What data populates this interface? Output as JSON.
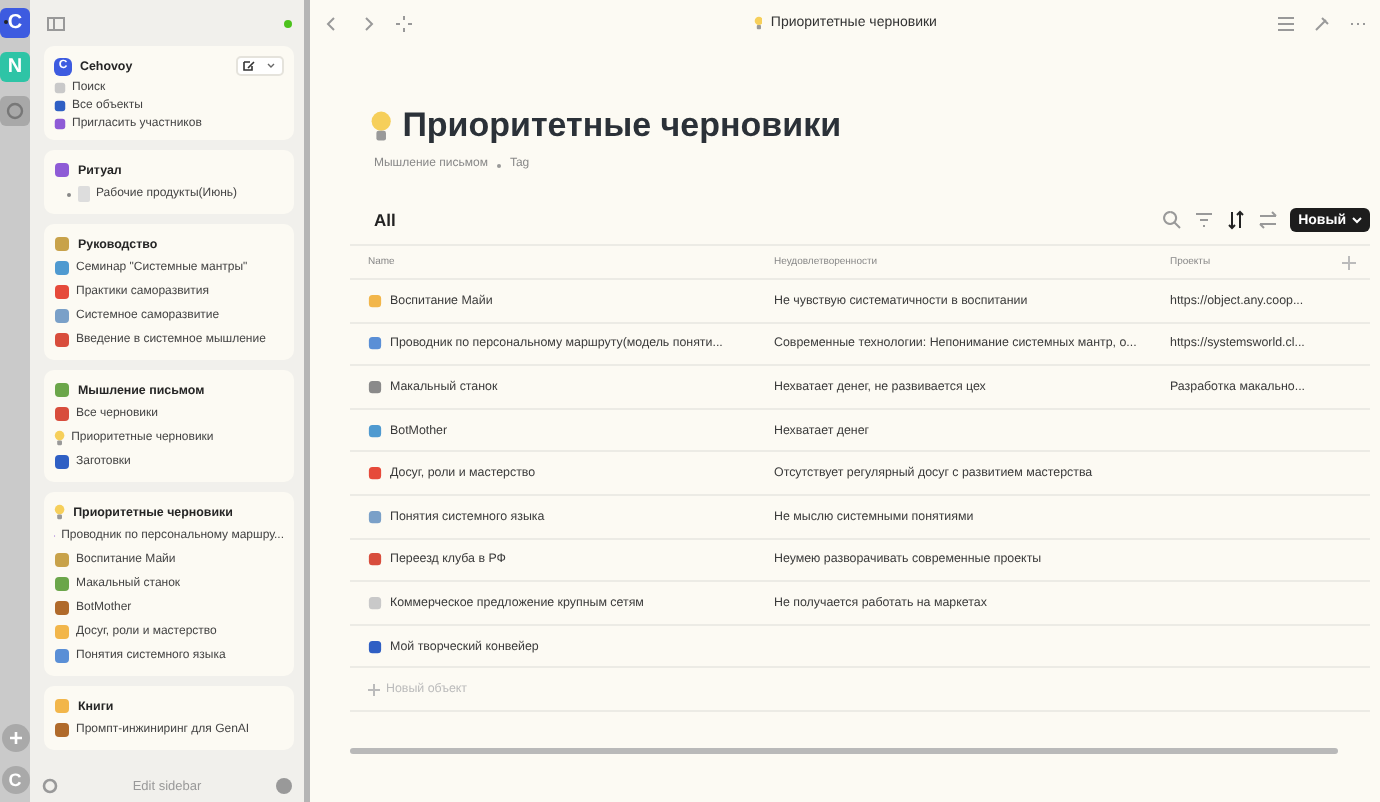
{
  "rail": {
    "spaces": [
      {
        "letter": "C",
        "color": "#3d5be0",
        "selected": true
      },
      {
        "letter": "N",
        "color": "#2ec4a6",
        "selected": false
      }
    ],
    "account": "C"
  },
  "sidebar": {
    "space": {
      "name": "Cehovoy",
      "logo": "C",
      "items": [
        "Поиск",
        "Все объекты",
        "Пригласить участников"
      ]
    },
    "widgets": [
      {
        "title": "Ритуал",
        "kind": "tree",
        "items": [
          "Рабочие продукты(Июнь)"
        ]
      },
      {
        "title": "Руководство",
        "kind": "list",
        "items": [
          "Семинар \"Системные мантры\"",
          "Практики саморазвития",
          "Системное саморазвитие",
          "Введение в системное мышление"
        ]
      },
      {
        "title": "Мышление письмом",
        "kind": "list",
        "items": [
          "Все черновики",
          "Приоритетные черновики",
          "Заготовки"
        ]
      },
      {
        "title": "Приоритетные черновики",
        "kind": "list",
        "items": [
          "Проводник по персональному маршру...",
          "Воспитание Майи",
          "Макальный станок",
          "BotMother",
          "Досуг, роли и мастерство",
          "Понятия системного языка"
        ]
      },
      {
        "title": "Книги",
        "kind": "list",
        "items": [
          "Промпт-инжиниринг для GenAI"
        ]
      }
    ],
    "footer": "Edit sidebar"
  },
  "topbar": {
    "title": "Приоритетные черновики"
  },
  "page": {
    "title": "Приоритетные черновики",
    "breadcrumb": [
      "Мышление письмом",
      "Tag"
    ],
    "view": "All",
    "new_button": "Новый",
    "table": {
      "columns": [
        "Name",
        "Неудовлетворенности",
        "Проекты"
      ],
      "rows": [
        {
          "name": "Воспитание Майи",
          "col2": "Не чувствую систематичности в воспитании",
          "col3": "https://object.any.coop..."
        },
        {
          "name": "Проводник по персональному маршруту(модель поняти...",
          "col2": "Современные технологии: Непонимание системных мантр, о...",
          "col3": "https://systemsworld.cl..."
        },
        {
          "name": "Макальный станок",
          "col2": "Нехватает денег, не развивается цех",
          "col3": "Разработка макально..."
        },
        {
          "name": "BotMother",
          "col2": "Нехватает денег"
        },
        {
          "name": "Досуг, роли и мастерство",
          "col2": "Отсутствует регулярный досуг с развитием мастерства"
        },
        {
          "name": "Понятия системного языка",
          "col2": "Не мыслю системными понятиями"
        },
        {
          "name": "Переезд клуба в РФ",
          "col2": "Неумею разворачивать современные проекты"
        },
        {
          "name": "Коммерческое предложение крупным сетям",
          "col2": "Не получается работать на маркетах"
        },
        {
          "name": "Мой творческий конвейер"
        }
      ],
      "add_row": "Новый объект"
    }
  }
}
